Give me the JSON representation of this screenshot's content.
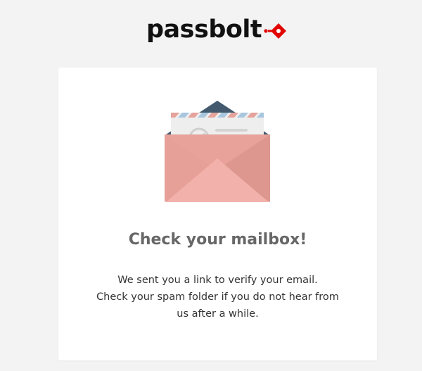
{
  "brand": {
    "name": "passbolt",
    "accent_color": "#e10600"
  },
  "card": {
    "illustration": "envelope-with-check-letter",
    "title": "Check your mailbox!",
    "message_lines": [
      "We sent you a link to verify your email.",
      "Check your spam folder if you do not hear from",
      "us after a while."
    ]
  }
}
